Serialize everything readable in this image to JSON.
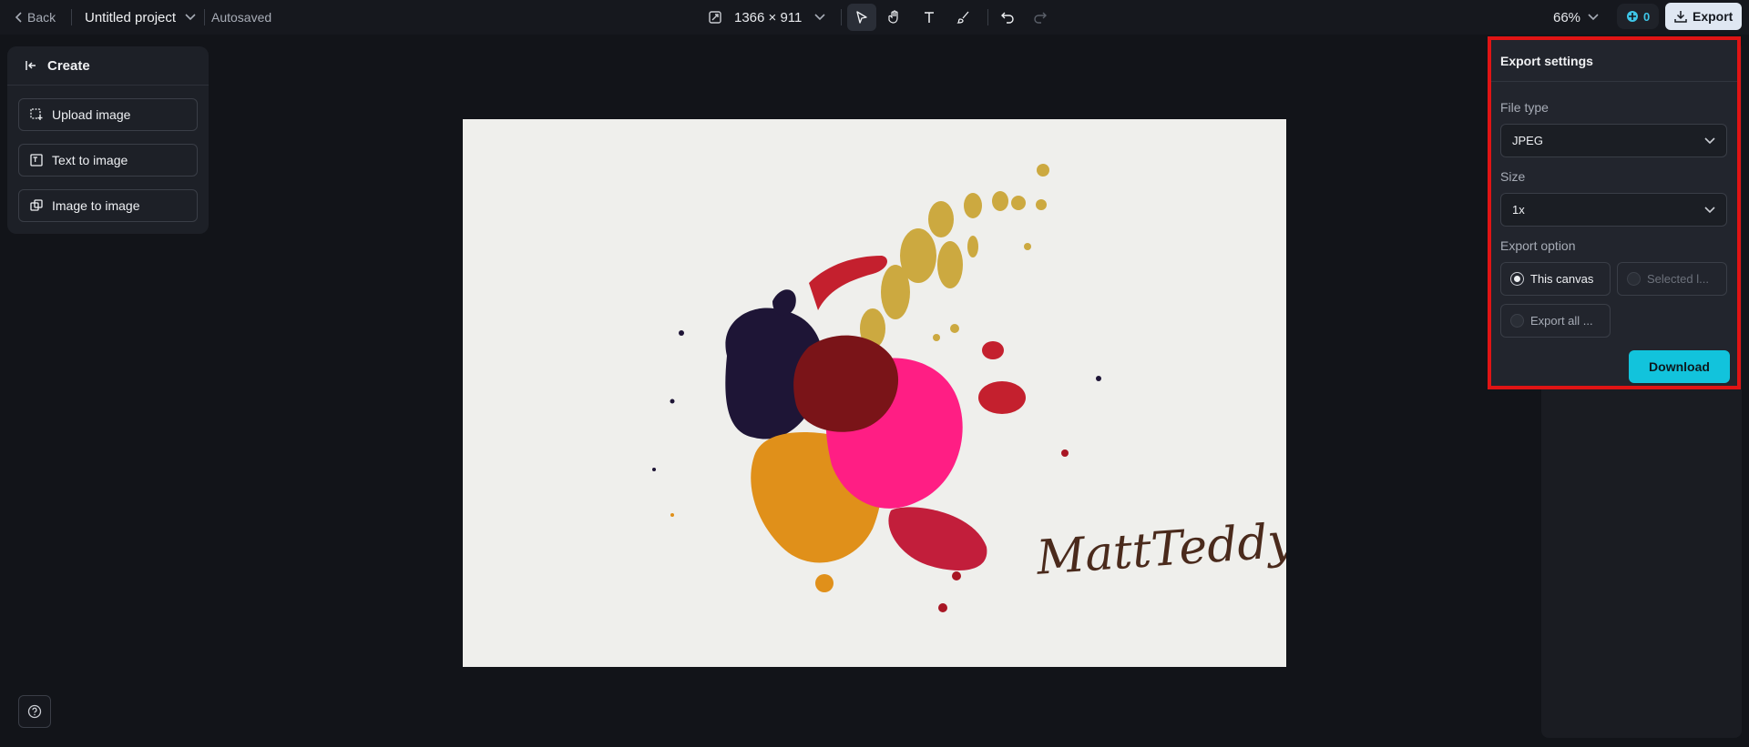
{
  "topbar": {
    "back_label": "Back",
    "project_title": "Untitled project",
    "autosave_status": "Autosaved",
    "canvas_size": "1366 × 911",
    "zoom": "66%",
    "credits": "0",
    "export_label": "Export",
    "tools": [
      "select-tool",
      "hand-tool",
      "text-tool",
      "brush-tool",
      "undo",
      "redo"
    ]
  },
  "left_panel": {
    "header": "Create",
    "items": [
      {
        "label": "Upload image",
        "icon": "upload-image-icon"
      },
      {
        "label": "Text to image",
        "icon": "text-to-image-icon"
      },
      {
        "label": "Image to image",
        "icon": "image-to-image-icon"
      }
    ]
  },
  "canvas": {
    "watermark_text": "MattTeddy"
  },
  "export_panel": {
    "title": "Export settings",
    "file_type_label": "File type",
    "file_type_value": "JPEG",
    "size_label": "Size",
    "size_value": "1x",
    "export_option_label": "Export option",
    "options": [
      {
        "label": "This canvas",
        "selected": true,
        "enabled": true
      },
      {
        "label": "Selected l...",
        "selected": false,
        "enabled": false
      },
      {
        "label": "Export all ...",
        "selected": false,
        "enabled": false
      }
    ],
    "download_label": "Download"
  },
  "colors": {
    "accent": "#12c3dc",
    "highlight_border": "#e01414",
    "background": "#121419"
  }
}
